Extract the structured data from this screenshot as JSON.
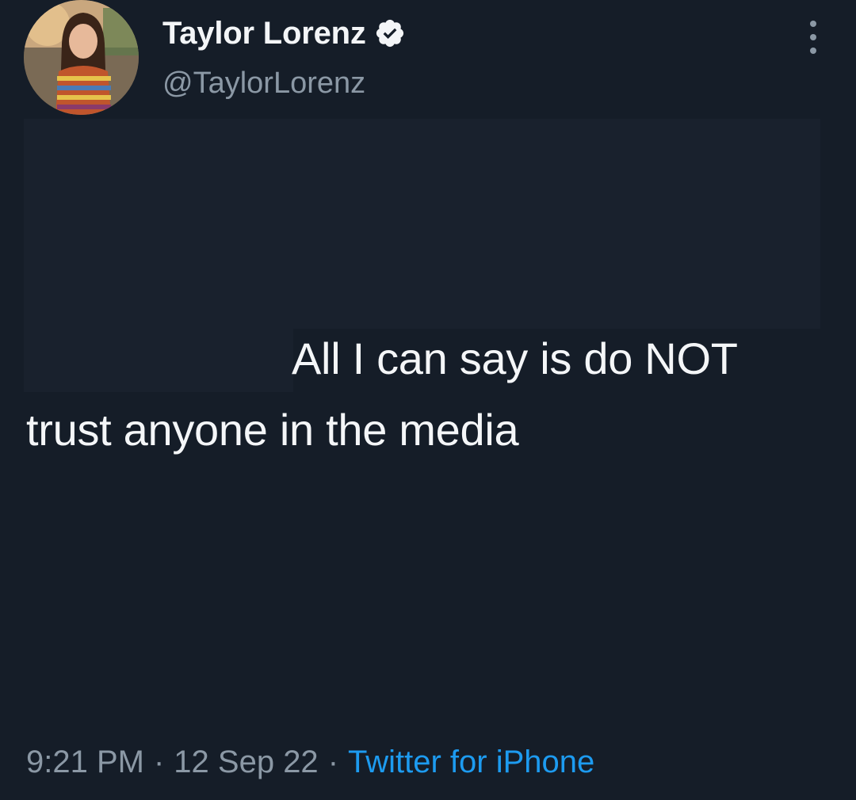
{
  "tweet": {
    "author": {
      "display_name": "Taylor Lorenz",
      "handle": "@TaylorLorenz",
      "verified_icon": "verified-badge-icon",
      "avatar_icon": "avatar-photo"
    },
    "menu_icon": "more-vertical-icon",
    "text_line_1": "All I can say is do NOT",
    "text_line_2": "trust anyone in the media",
    "time": "9:21 PM",
    "separator": "·",
    "date": "12 Sep 22",
    "source": "Twitter for iPhone"
  },
  "colors": {
    "background": "#151d28",
    "text": "#f4f6f8",
    "muted": "#8b98a5",
    "link": "#1d9bf0"
  }
}
